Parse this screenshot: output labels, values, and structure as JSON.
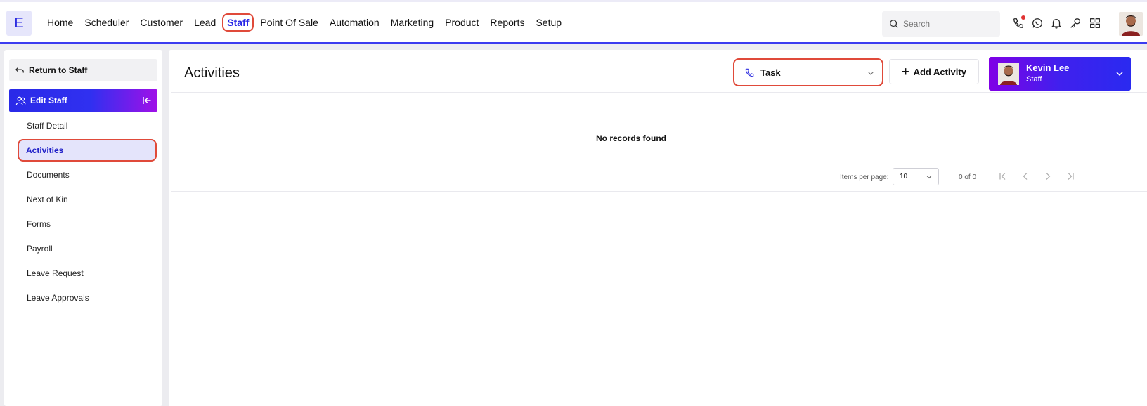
{
  "logo": {
    "letter": "E"
  },
  "nav": {
    "items": [
      {
        "label": "Home"
      },
      {
        "label": "Scheduler"
      },
      {
        "label": "Customer"
      },
      {
        "label": "Lead"
      },
      {
        "label": "Staff",
        "active": true
      },
      {
        "label": "Point Of Sale"
      },
      {
        "label": "Automation"
      },
      {
        "label": "Marketing"
      },
      {
        "label": "Product"
      },
      {
        "label": "Reports"
      },
      {
        "label": "Setup"
      }
    ]
  },
  "search": {
    "placeholder": "Search"
  },
  "top_icons": [
    "phone-icon",
    "whatsapp-icon",
    "bell-icon",
    "key-icon",
    "grid-icon"
  ],
  "sidebar": {
    "return_label": "Return to Staff",
    "section_label": "Edit Staff",
    "items": [
      {
        "label": "Staff Detail"
      },
      {
        "label": "Activities",
        "active": true
      },
      {
        "label": "Documents"
      },
      {
        "label": "Next of Kin"
      },
      {
        "label": "Forms"
      },
      {
        "label": "Payroll"
      },
      {
        "label": "Leave Request"
      },
      {
        "label": "Leave Approvals"
      }
    ]
  },
  "main": {
    "title": "Activities",
    "type_select": {
      "value": "Task"
    },
    "add_button": "Add Activity",
    "user": {
      "name": "Kevin Lee",
      "role": "Staff"
    },
    "empty_message": "No records found",
    "pagination": {
      "items_per_page_label": "Items per page:",
      "items_per_page": "10",
      "range": "0 of 0"
    }
  },
  "colors": {
    "accent": "#2a2ae8",
    "highlight": "#e04a3a",
    "gradient_end": "#8000e6"
  }
}
